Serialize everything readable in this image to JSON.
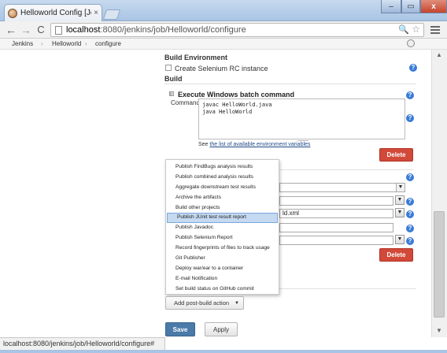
{
  "browser": {
    "tab_title": "Helloworld Config [Je",
    "tab_close": "×",
    "url_host": "localhost",
    "url_path": ":8080/jenkins/job/Helloworld/configure",
    "back_glyph": "←",
    "forward_glyph": "→",
    "reload_glyph": "C",
    "search_glyph": "🔍",
    "star_glyph": "☆",
    "win_min": "–",
    "win_max": "▭",
    "win_close": "x",
    "status_text": "localhost:8080/jenkins/job/Helloworld/configure#"
  },
  "breadcrumb": {
    "items": [
      "Jenkins",
      "Helloworld",
      "configure"
    ],
    "separator": "›"
  },
  "build_environment": {
    "title": "Build Environment",
    "selenium_label": "Create Selenium RC instance"
  },
  "build": {
    "title": "Build",
    "step_title": "Execute Windows batch command",
    "command_label": "Command",
    "command_value": "javac HelloWorld.java\njava HelloWorld",
    "see_prefix": "See ",
    "see_link": "the list of available environment variables",
    "delete_label": "Delete"
  },
  "background_fields": {
    "xml_value": "ld.xml",
    "arrow": "▼"
  },
  "help_glyph": "?",
  "post_build_menu": {
    "items": [
      "Publish FindBugs analysis results",
      "Publish combined analysis results",
      "Aggregate downstream test results",
      "Archive the artifacts",
      "Build other projects",
      "Publish JUnit test result report",
      "Publish Javadoc",
      "Publish Selenium Report",
      "Record fingerprints of files to track usage",
      "Git Publisher",
      "Deploy war/ear to a container",
      "E-mail Notification",
      "Set build status on GitHub commit"
    ],
    "selected": "Publish JUnit test result report"
  },
  "buttons": {
    "add_post_build": "Add post-build action",
    "caret": "▼",
    "save": "Save",
    "apply": "Apply"
  },
  "scrollbar": {
    "up": "▲",
    "down": "▼"
  }
}
